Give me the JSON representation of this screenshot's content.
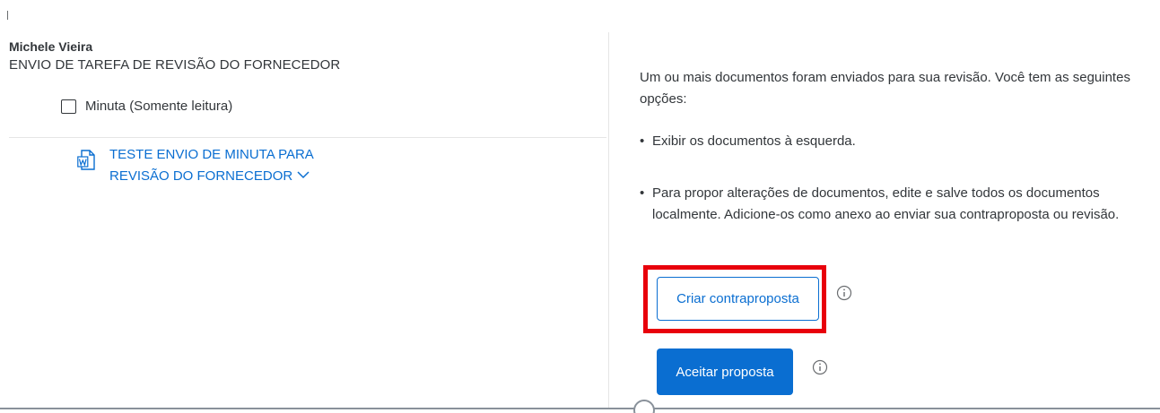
{
  "review": {
    "author": "Michele Vieira",
    "task_title": "ENVIO DE TAREFA DE REVISÃO DO FORNECEDOR",
    "folder_label": "Minuta (Somente leitura)",
    "document": {
      "name_line1": "TESTE ENVIO DE MINUTA PARA",
      "name_line2": "REVISÃO DO FORNECEDOR",
      "icon": "word-document-icon",
      "expand_icon": "chevron-down-icon"
    }
  },
  "instructions": {
    "intro": "Um ou mais documentos foram enviados para sua revisão. Você tem as seguintes opções:",
    "bullets": [
      "Exibir os documentos à esquerda.",
      "Para propor alterações de documentos, edite e salve todos os documentos localmente. Adicione-os como anexo ao enviar sua contraproposta ou revisão."
    ]
  },
  "actions": {
    "counter_proposal_label": "Criar contraproposta",
    "accept_proposal_label": "Aceitar proposta",
    "info_icon": "info-icon"
  },
  "colors": {
    "accent": "#0a6ed1",
    "highlight": "#e8000b",
    "text": "#32363a"
  }
}
